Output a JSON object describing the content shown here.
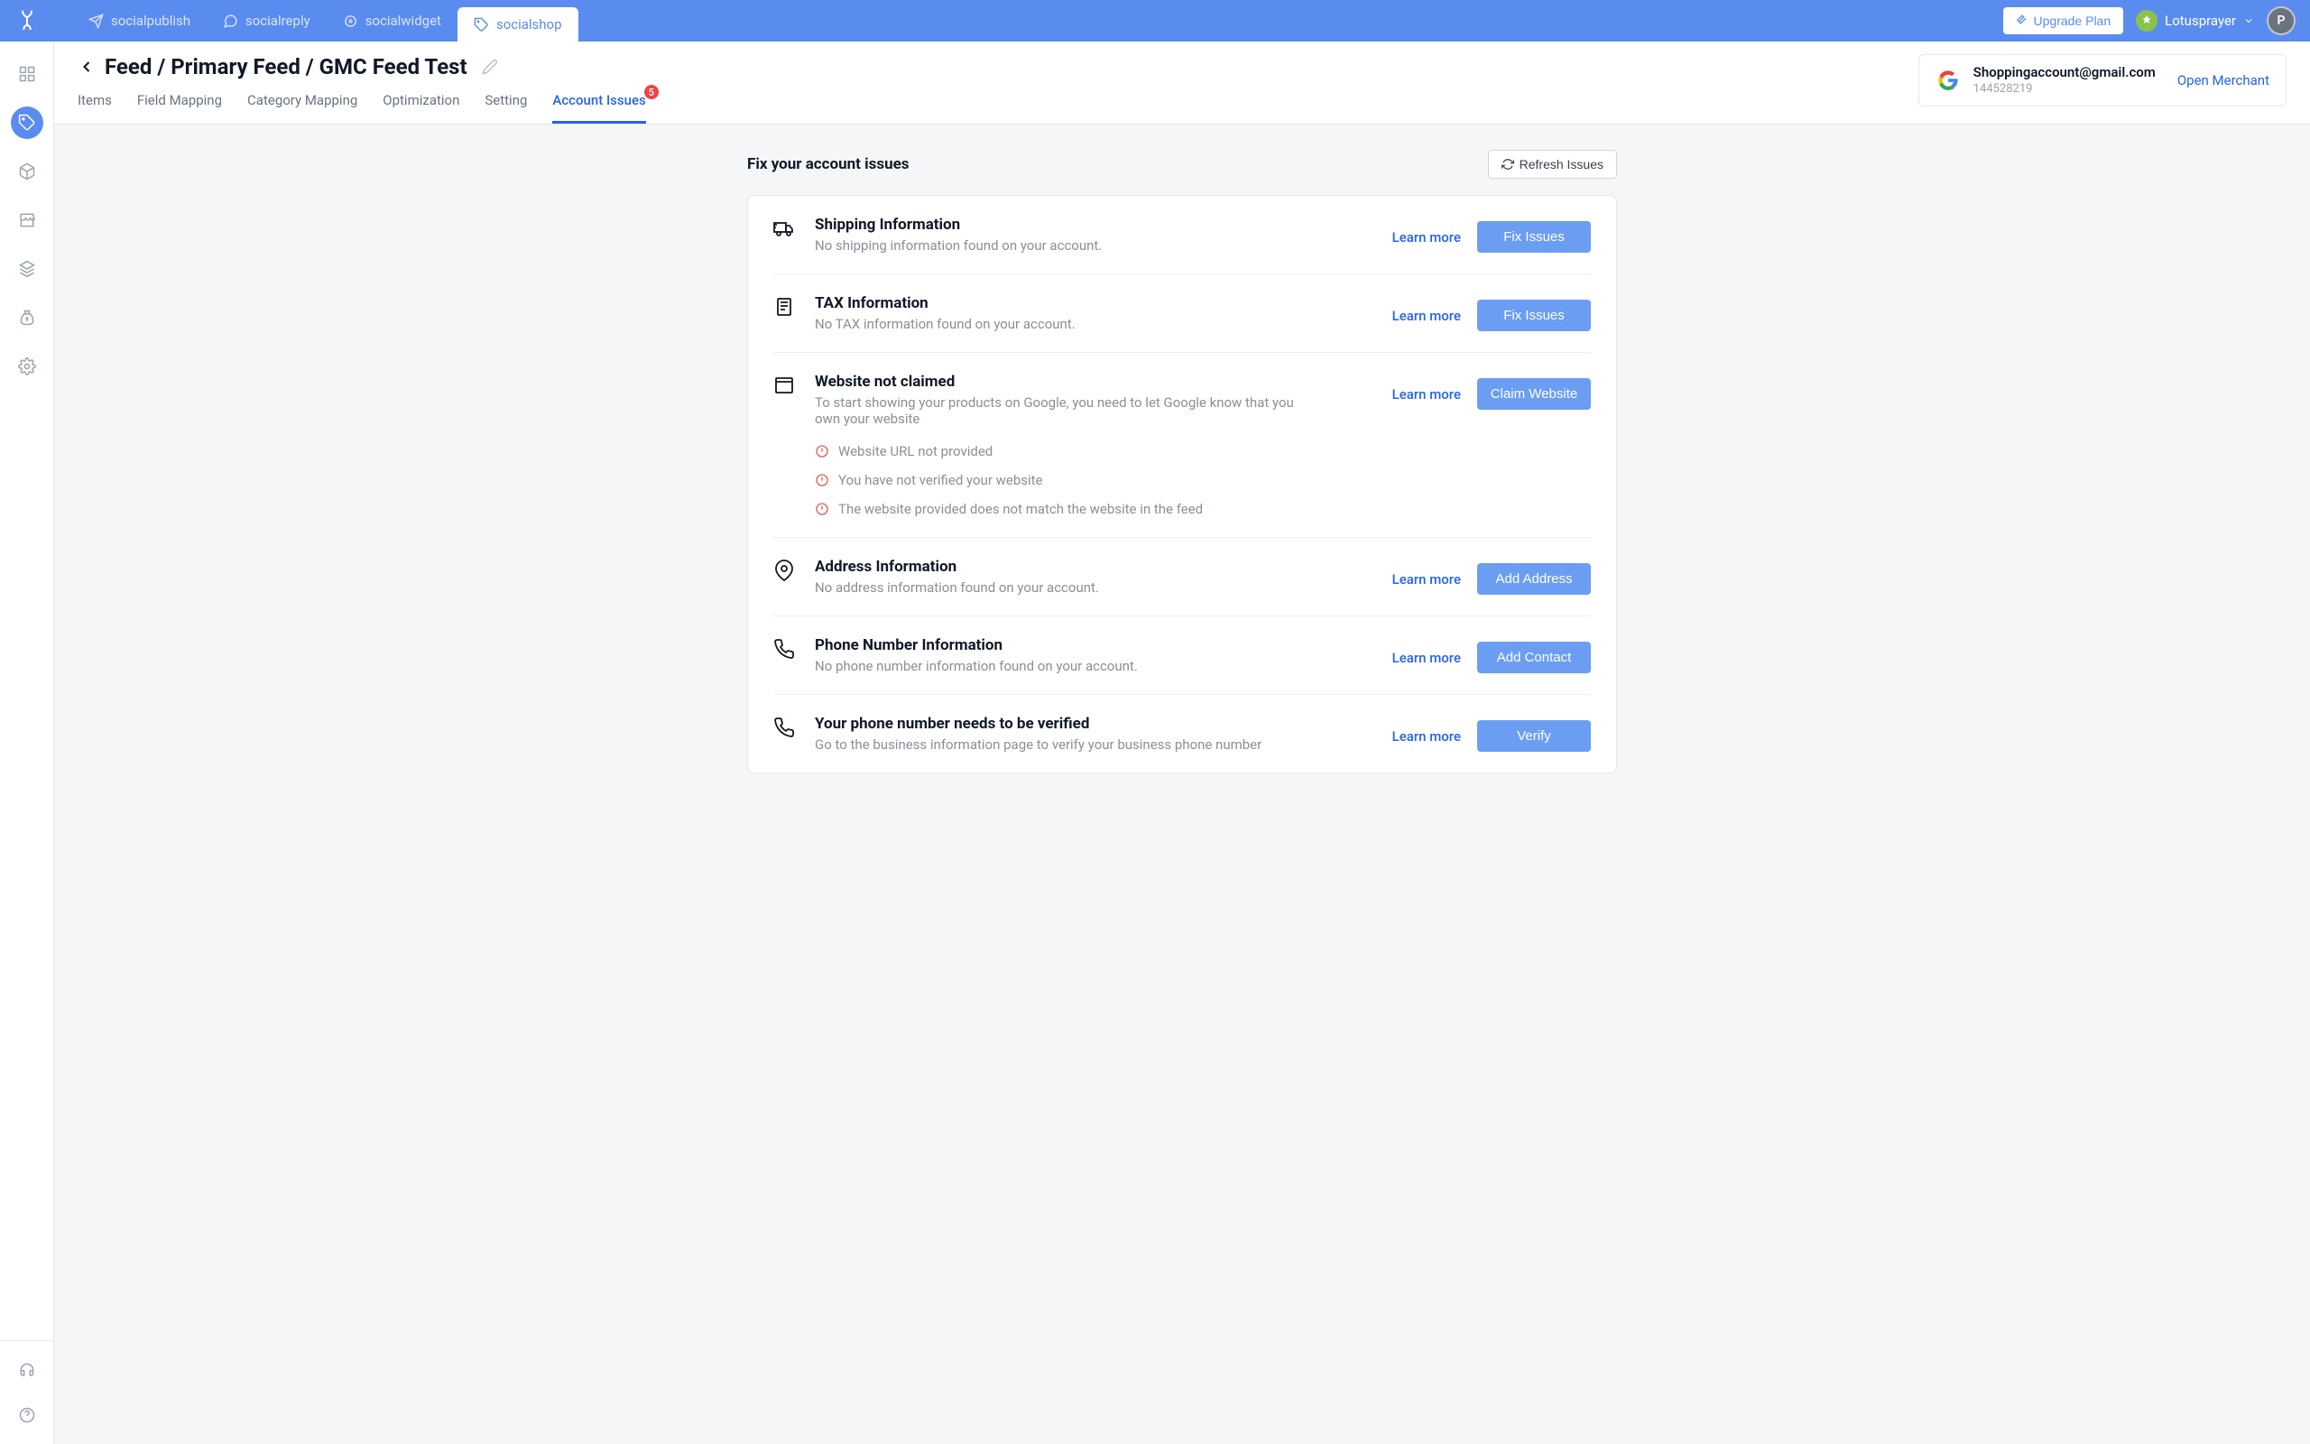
{
  "topbar": {
    "tabs": [
      {
        "label": "socialpublish"
      },
      {
        "label": "socialreply"
      },
      {
        "label": "socialwidget"
      },
      {
        "label": "socialshop"
      }
    ],
    "upgrade_label": "Upgrade Plan",
    "username": "Lotusprayer",
    "avatar_initial": "P"
  },
  "breadcrumb": {
    "text": "Feed / Primary Feed / GMC Feed Test"
  },
  "subtabs": {
    "items": [
      {
        "label": "Items"
      },
      {
        "label": "Field Mapping"
      },
      {
        "label": "Category Mapping"
      },
      {
        "label": "Optimization"
      },
      {
        "label": "Setting"
      },
      {
        "label": "Account Issues",
        "badge": "5"
      }
    ]
  },
  "merchant": {
    "email": "Shoppingaccount@gmail.com",
    "id": "144528219",
    "open_label": "Open Merchant"
  },
  "section": {
    "title": "Fix your account issues",
    "refresh_label": "Refresh Issues",
    "learn_more": "Learn more"
  },
  "issues": [
    {
      "title": "Shipping Information",
      "desc": "No shipping information found on your account.",
      "button": "Fix Issues"
    },
    {
      "title": "TAX Information",
      "desc": "No TAX information found on your account.",
      "button": "Fix Issues"
    },
    {
      "title": "Website not claimed",
      "desc": "To start showing your products on Google, you need to let Google know that you own your website",
      "button": "Claim Website",
      "subitems": [
        "Website URL not provided",
        "You have not verified your website",
        "The website provided does not match the website in the feed"
      ]
    },
    {
      "title": "Address Information",
      "desc": "No address information found on your account.",
      "button": "Add Address"
    },
    {
      "title": "Phone Number Information",
      "desc": "No phone number information found on your account.",
      "button": "Add Contact"
    },
    {
      "title": "Your phone number needs to be verified",
      "desc": "Go to the business information page to verify your business phone number",
      "button": "Verify"
    }
  ]
}
